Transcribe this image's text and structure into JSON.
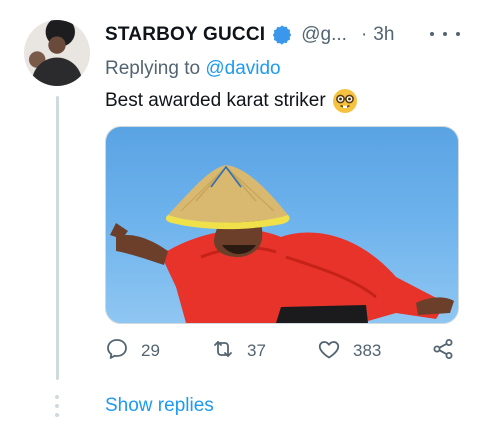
{
  "tweet": {
    "name": "STARBOY GUCCI",
    "handle": "@g...",
    "separator": "·",
    "time": "3h",
    "replying_prefix": "Replying to",
    "replying_to": "@davido",
    "text": "Best awarded karat striker",
    "emoji_icon": "nerd-face-icon",
    "verified_icon": "verified-badge-icon",
    "verified_color": "#1d9bf0",
    "media_description_hidden": true
  },
  "actions": {
    "replies": "29",
    "retweets": "37",
    "likes": "383",
    "share_icon": "share-icon"
  },
  "show_replies_label": "Show replies",
  "colors": {
    "accent": "#1d9bf0",
    "secondary_text": "#536471",
    "primary_text": "#0f1419",
    "thread_line": "#cfd9de"
  }
}
